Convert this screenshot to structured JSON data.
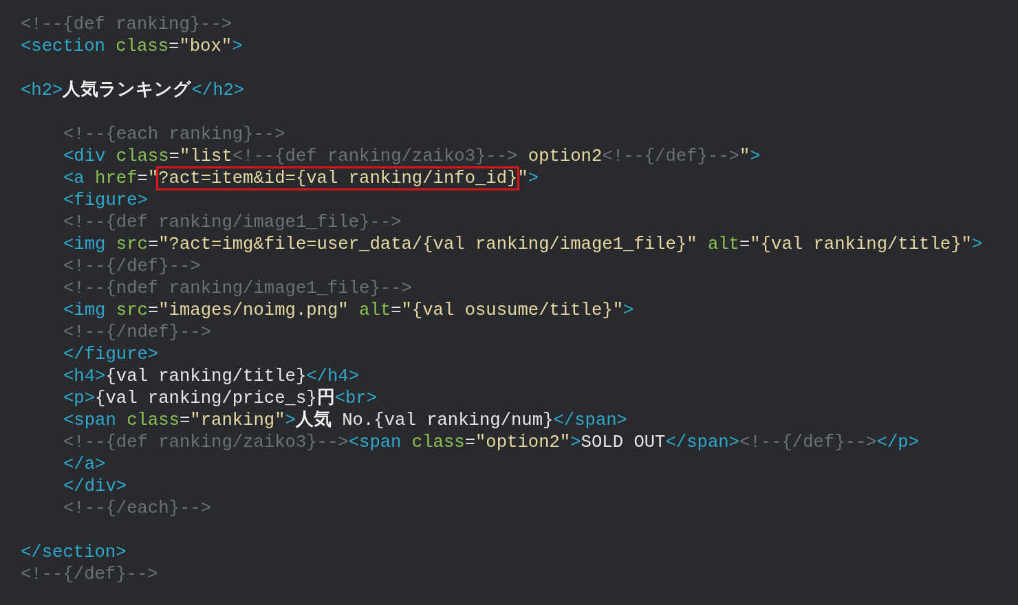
{
  "editor": {
    "lines": [
      {
        "kind": "code",
        "tokens": [
          {
            "kind": "comment",
            "text": "<!--{def ranking}-->"
          }
        ]
      },
      {
        "kind": "code",
        "tokens": [
          {
            "kind": "tag",
            "text": "<section"
          },
          {
            "kind": "attr",
            "text": " class"
          },
          {
            "kind": "plain",
            "text": "="
          },
          {
            "kind": "string",
            "text": "\"box\""
          },
          {
            "kind": "tag",
            "text": ">"
          }
        ]
      },
      {
        "kind": "blank"
      },
      {
        "kind": "code",
        "tokens": [
          {
            "kind": "tag",
            "text": "<h2>"
          },
          {
            "kind": "strong",
            "text": "人気ランキング"
          },
          {
            "kind": "tag",
            "text": "</h2>"
          }
        ]
      },
      {
        "kind": "blank"
      },
      {
        "kind": "block",
        "children": [
          {
            "kind": "code",
            "tokens": [
              {
                "kind": "comment",
                "text": "<!--{each ranking}-->"
              }
            ]
          },
          {
            "kind": "code",
            "tokens": [
              {
                "kind": "tag",
                "text": "<div"
              },
              {
                "kind": "attr",
                "text": " class"
              },
              {
                "kind": "plain",
                "text": "="
              },
              {
                "kind": "string",
                "text": "\"list"
              },
              {
                "kind": "comment",
                "text": "<!--{def ranking/zaiko3}-->"
              },
              {
                "kind": "string",
                "text": " option2"
              },
              {
                "kind": "comment",
                "text": "<!--{/def}-->"
              },
              {
                "kind": "string",
                "text": "\""
              },
              {
                "kind": "tag",
                "text": ">"
              }
            ]
          },
          {
            "kind": "code",
            "tokens": [
              {
                "kind": "tag",
                "text": "<a"
              },
              {
                "kind": "attr",
                "text": " href"
              },
              {
                "kind": "plain",
                "text": "="
              },
              {
                "kind": "string",
                "text": "\""
              },
              {
                "kind": "string",
                "text": "?act=item&id={val ranking/info_id}",
                "boxed": true
              },
              {
                "kind": "string",
                "text": "\""
              },
              {
                "kind": "tag",
                "text": ">"
              }
            ]
          },
          {
            "kind": "code",
            "tokens": [
              {
                "kind": "tag",
                "text": "<figure>"
              }
            ]
          },
          {
            "kind": "code",
            "tokens": [
              {
                "kind": "comment",
                "text": "<!--{def ranking/image1_file}-->"
              }
            ]
          },
          {
            "kind": "code",
            "tokens": [
              {
                "kind": "tag",
                "text": "<img"
              },
              {
                "kind": "attr",
                "text": " src"
              },
              {
                "kind": "plain",
                "text": "="
              },
              {
                "kind": "string",
                "text": "\"?act=img&file=user_data/{val ranking/image1_file}\""
              },
              {
                "kind": "attr",
                "text": " alt"
              },
              {
                "kind": "plain",
                "text": "="
              },
              {
                "kind": "string",
                "text": "\"{val ranking/title}\""
              },
              {
                "kind": "tag",
                "text": ">"
              }
            ]
          },
          {
            "kind": "code",
            "tokens": [
              {
                "kind": "comment",
                "text": "<!--{/def}-->"
              }
            ]
          },
          {
            "kind": "code",
            "tokens": [
              {
                "kind": "comment",
                "text": "<!--{ndef ranking/image1_file}-->"
              }
            ]
          },
          {
            "kind": "code",
            "tokens": [
              {
                "kind": "tag",
                "text": "<img"
              },
              {
                "kind": "attr",
                "text": " src"
              },
              {
                "kind": "plain",
                "text": "="
              },
              {
                "kind": "string",
                "text": "\"images/noimg.png\""
              },
              {
                "kind": "attr",
                "text": " alt"
              },
              {
                "kind": "plain",
                "text": "="
              },
              {
                "kind": "string",
                "text": "\"{val osusume/title}\""
              },
              {
                "kind": "tag",
                "text": ">"
              }
            ]
          },
          {
            "kind": "code",
            "tokens": [
              {
                "kind": "comment",
                "text": "<!--{/ndef}-->"
              }
            ]
          },
          {
            "kind": "code",
            "tokens": [
              {
                "kind": "tag",
                "text": "</figure>"
              }
            ]
          },
          {
            "kind": "code",
            "tokens": [
              {
                "kind": "tag",
                "text": "<h4>"
              },
              {
                "kind": "plain",
                "text": "{val ranking/title}"
              },
              {
                "kind": "tag",
                "text": "</h4>"
              }
            ]
          },
          {
            "kind": "code",
            "tokens": [
              {
                "kind": "tag",
                "text": "<p>"
              },
              {
                "kind": "plain",
                "text": "{val ranking/price_s}"
              },
              {
                "kind": "strong",
                "text": "円"
              },
              {
                "kind": "tag",
                "text": "<br>"
              }
            ]
          },
          {
            "kind": "code",
            "tokens": [
              {
                "kind": "tag",
                "text": "<span"
              },
              {
                "kind": "attr",
                "text": " class"
              },
              {
                "kind": "plain",
                "text": "="
              },
              {
                "kind": "string",
                "text": "\"ranking\""
              },
              {
                "kind": "tag",
                "text": ">"
              },
              {
                "kind": "strong",
                "text": "人気"
              },
              {
                "kind": "plain",
                "text": " No.{val ranking/num}"
              },
              {
                "kind": "tag",
                "text": "</span>"
              }
            ]
          },
          {
            "kind": "code",
            "tokens": [
              {
                "kind": "comment",
                "text": "<!--{def ranking/zaiko3}-->"
              },
              {
                "kind": "tag",
                "text": "<span"
              },
              {
                "kind": "attr",
                "text": " class"
              },
              {
                "kind": "plain",
                "text": "="
              },
              {
                "kind": "string",
                "text": "\"option2\""
              },
              {
                "kind": "tag",
                "text": ">"
              },
              {
                "kind": "plain",
                "text": "SOLD OUT"
              },
              {
                "kind": "tag",
                "text": "</span>"
              },
              {
                "kind": "comment",
                "text": "<!--{/def}-->"
              },
              {
                "kind": "tag",
                "text": "</p>"
              }
            ]
          },
          {
            "kind": "code",
            "tokens": [
              {
                "kind": "tag",
                "text": "</a>"
              }
            ]
          },
          {
            "kind": "code",
            "tokens": [
              {
                "kind": "tag",
                "text": "</div>"
              }
            ]
          },
          {
            "kind": "code",
            "tokens": [
              {
                "kind": "comment",
                "text": "<!--{/each}-->"
              }
            ]
          }
        ]
      },
      {
        "kind": "blank"
      },
      {
        "kind": "code",
        "tokens": [
          {
            "kind": "tag",
            "text": "</section>"
          }
        ]
      },
      {
        "kind": "code",
        "tokens": [
          {
            "kind": "comment",
            "text": "<!--{/def}-->"
          }
        ]
      }
    ]
  }
}
